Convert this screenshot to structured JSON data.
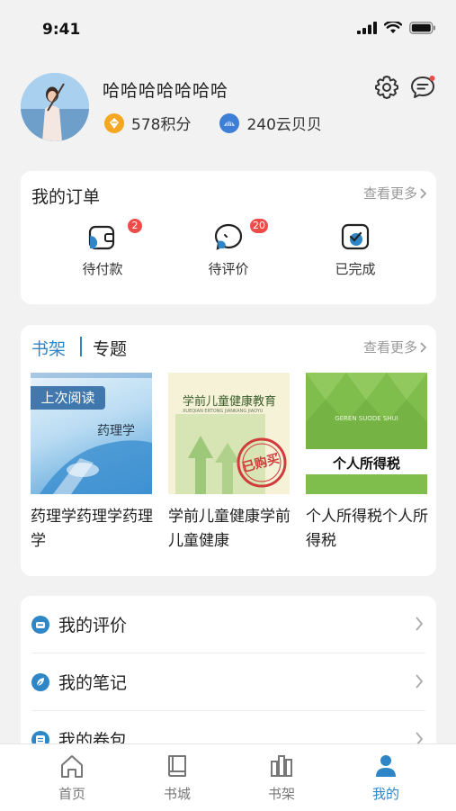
{
  "status": {
    "time": "9:41"
  },
  "profile": {
    "username": "哈哈哈哈哈哈哈",
    "points": "578积分",
    "shells": "240云贝贝"
  },
  "orders": {
    "title": "我的订单",
    "more": "查看更多",
    "items": [
      {
        "label": "待付款",
        "badge": "2"
      },
      {
        "label": "待评价",
        "badge": "20"
      },
      {
        "label": "已完成",
        "badge": ""
      }
    ]
  },
  "shelf": {
    "tab_active": "书架",
    "tab_other": "专题",
    "more": "查看更多",
    "books": [
      {
        "title": "药理学药理学药理学",
        "cover_title": "药理学",
        "last_read_label": "上次阅读"
      },
      {
        "title": "学前儿童健康学前儿童健康",
        "cover_title": "学前儿童健康教育",
        "cover_pinyin": "XUEQIAN ERTONG JIANKANG JIAOYU",
        "stamp": "已购买"
      },
      {
        "title": "个人所得税个人所得税",
        "cover_title": "个人所得税",
        "cover_pinyin": "GEREN SUODE SHUI"
      }
    ]
  },
  "menu": {
    "items": [
      {
        "label": "我的评价",
        "icon": "comment-icon"
      },
      {
        "label": "我的笔记",
        "icon": "leaf-icon"
      },
      {
        "label": "我的卷包",
        "icon": "ticket-icon"
      }
    ]
  },
  "tabbar": {
    "items": [
      {
        "label": "首页",
        "icon": "home-icon"
      },
      {
        "label": "书城",
        "icon": "book-icon"
      },
      {
        "label": "书架",
        "icon": "bookshelf-icon"
      },
      {
        "label": "我的",
        "icon": "person-icon",
        "active": true
      }
    ]
  },
  "colors": {
    "accent": "#2f86c7",
    "badge": "#ee4b4b",
    "background": "#f2f2f2"
  }
}
